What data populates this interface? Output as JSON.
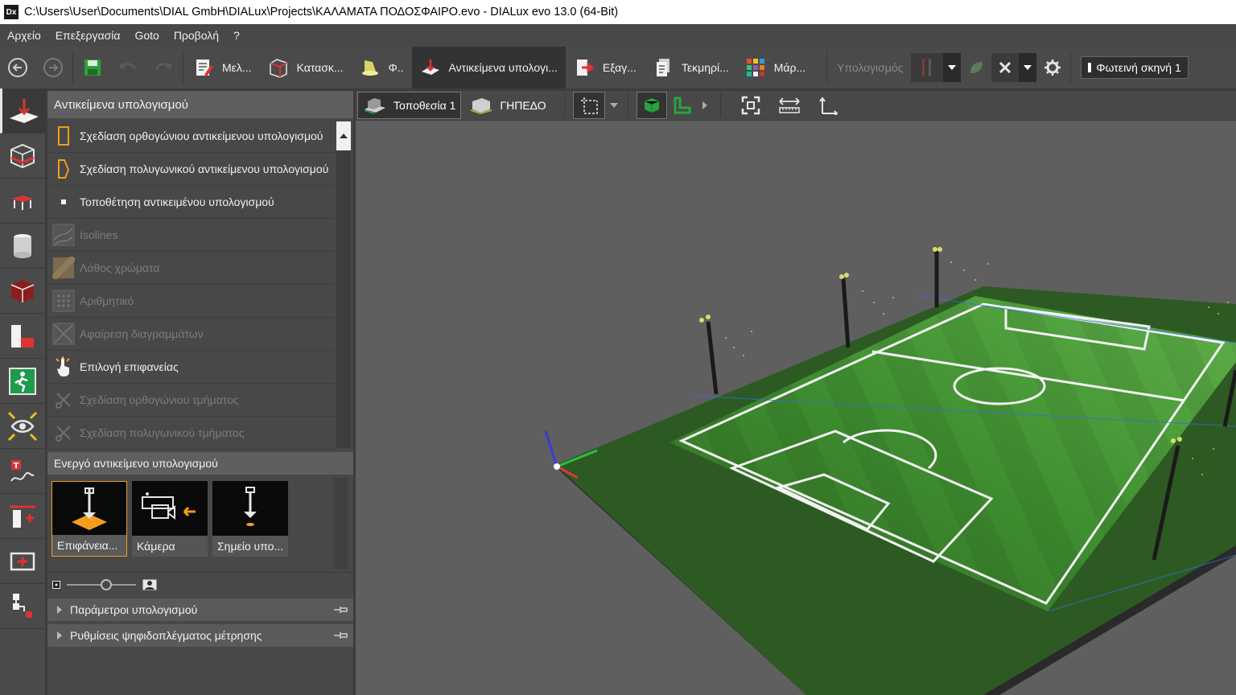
{
  "window": {
    "title": "C:\\Users\\User\\Documents\\DIAL GmbH\\DIALux\\Projects\\ΚΑΛΑΜΑΤΑ ΠΟΔΟΣΦΑΙΡΟ.evo - DIALux evo 13.0  (64-Bit)",
    "app_icon": "Dx"
  },
  "menu": [
    "Αρχείο",
    "Επεξεργασία",
    "Goto",
    "Προβολή",
    "?"
  ],
  "toolbar": {
    "tabs": [
      {
        "label": "Μελ...",
        "icon": "project-icon"
      },
      {
        "label": "Κατασκ...",
        "icon": "construction-icon"
      },
      {
        "label": "Φ..",
        "icon": "luminaire-icon"
      },
      {
        "label": "Αντικείμενα υπολογι...",
        "icon": "calc-objects-icon",
        "active": true
      },
      {
        "label": "Εξαγ...",
        "icon": "export-icon"
      },
      {
        "label": "Τεκμηρί...",
        "icon": "documentation-icon"
      },
      {
        "label": "Μάρ...",
        "icon": "marketplace-icon"
      }
    ],
    "calc_label": "Υπολογισμός",
    "scene_label": "Φωτεινή σκηνή 1",
    "accent_color": "#f39c1e"
  },
  "panel": {
    "title": "Αντικείμενα υπολογισμού",
    "tools": [
      {
        "label": "Σχεδίαση ορθογώνιου αντικείμενου υπολογισμού",
        "enabled": true,
        "icon": "rectangle-draw-icon"
      },
      {
        "label": "Σχεδίαση πολυγωνικού αντικείμενου υπολογισμού",
        "enabled": true,
        "icon": "polygon-draw-icon"
      },
      {
        "label": "Τοποθέτηση αντικειμένου υπολογισμού",
        "enabled": true,
        "icon": "place-point-icon"
      },
      {
        "label": "Isolines",
        "enabled": false,
        "icon": "isolines-icon"
      },
      {
        "label": "Λάθος χρώματα",
        "enabled": false,
        "icon": "false-colors-icon"
      },
      {
        "label": "Αριθμητικό",
        "enabled": false,
        "icon": "numeric-grid-icon"
      },
      {
        "label": "Αφαίρεση διαγραμμάτων",
        "enabled": false,
        "icon": "remove-diagrams-icon"
      },
      {
        "label": "Επιλογή επιφανείας",
        "enabled": true,
        "icon": "select-surface-icon"
      },
      {
        "label": "Σχεδίαση ορθογώνιου τμήματος",
        "enabled": false,
        "icon": "cut-rectangle-icon"
      },
      {
        "label": "Σχεδίαση πολυγωνικού τμήματος",
        "enabled": false,
        "icon": "cut-polygon-icon"
      }
    ],
    "active_section": "Ενεργό αντικείμενο υπολογισμού",
    "cards": [
      {
        "label": "Επιφάνεια...",
        "icon": "surface-calc-icon",
        "selected": true
      },
      {
        "label": "Κάμερα",
        "icon": "camera-icon",
        "selected": false
      },
      {
        "label": "Σημείο υπο...",
        "icon": "calc-point-icon",
        "selected": false
      }
    ],
    "collapsed": [
      "Παράμετροι υπολογισμού",
      "Ρυθμίσεις ψηφιδοπλέγματος μέτρησης"
    ]
  },
  "viewport_toolbar": {
    "location": "Τοποθεσία 1",
    "building": "ΓΗΠΕΔΟ"
  }
}
